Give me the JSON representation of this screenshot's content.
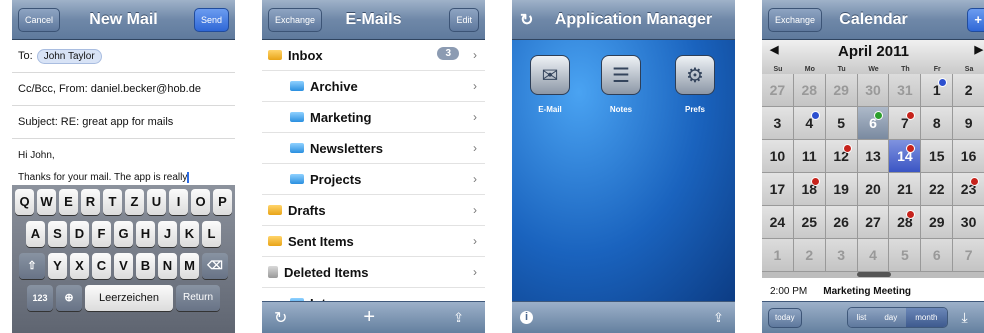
{
  "mail": {
    "cancel": "Cancel",
    "title": "New Mail",
    "send": "Send",
    "to_label": "To:",
    "to_recipient": "John Taylor",
    "ccbcc": "Cc/Bcc, From: daniel.becker@hob.de",
    "subject": "Subject: RE: great app for mails",
    "body_line1": "Hi John,",
    "body_line2": "Thanks for your mail. The app is really",
    "keyboard": {
      "row1": [
        "Q",
        "W",
        "E",
        "R",
        "T",
        "Z",
        "U",
        "I",
        "O",
        "P"
      ],
      "row2": [
        "A",
        "S",
        "D",
        "F",
        "G",
        "H",
        "J",
        "K",
        "L"
      ],
      "row3": [
        "Y",
        "X",
        "C",
        "V",
        "B",
        "N",
        "M"
      ],
      "num_key": "123",
      "space_key": "Leerzeichen",
      "return_key": "Return"
    }
  },
  "emails": {
    "back": "Exchange",
    "title": "E-Mails",
    "edit": "Edit",
    "folders": [
      {
        "name": "Inbox",
        "badge": "3"
      },
      {
        "name": "Archive"
      },
      {
        "name": "Marketing"
      },
      {
        "name": "Newsletters"
      },
      {
        "name": "Projects"
      },
      {
        "name": "Drafts"
      },
      {
        "name": "Sent Items"
      },
      {
        "name": "Deleted Items"
      },
      {
        "name": "Intern"
      }
    ]
  },
  "appmanager": {
    "title": "Application Manager",
    "apps": [
      {
        "label": "E-Mail",
        "icon": "email-icon"
      },
      {
        "label": "Notes",
        "icon": "notes-icon"
      },
      {
        "label": "Prefs",
        "icon": "prefs-icon"
      }
    ]
  },
  "calendar": {
    "back": "Exchange",
    "title": "Calendar",
    "add": "+",
    "month": "April 2011",
    "dows": [
      "Su",
      "Mo",
      "Tu",
      "We",
      "Th",
      "Fr",
      "Sa"
    ],
    "days": [
      "27",
      "28",
      "29",
      "30",
      "31",
      "1",
      "2",
      "3",
      "4",
      "5",
      "6",
      "7",
      "8",
      "9",
      "10",
      "11",
      "12",
      "13",
      "14",
      "15",
      "16",
      "17",
      "18",
      "19",
      "20",
      "21",
      "22",
      "23",
      "24",
      "25",
      "26",
      "27",
      "28",
      "29",
      "30",
      "1",
      "2",
      "3",
      "4",
      "5",
      "6",
      "7"
    ],
    "event_time": "2:00 PM",
    "event_title": "Marketing Meeting",
    "today": "today",
    "views": [
      "list",
      "day",
      "month"
    ]
  }
}
